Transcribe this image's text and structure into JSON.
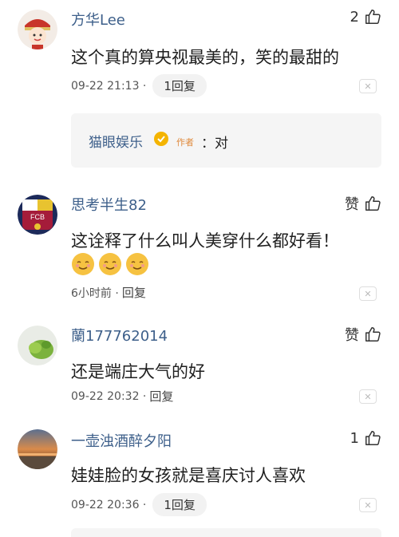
{
  "comments": [
    {
      "username": "方华Lee",
      "like_count": "2",
      "text": "这个真的算央视最美的，笑的最甜的",
      "time": "09-22 21:13 ·",
      "reply_label": "1回复",
      "close": "✕",
      "sub_reply": {
        "username": "猫眼娱乐",
        "author_tag": "作者",
        "text": "：对"
      }
    },
    {
      "username": "思考半生82",
      "like_count": "赞",
      "text": "这诠释了什么叫人美穿什么都好看！",
      "time": "6小时前 ·",
      "reply_label": "回复",
      "close": "✕"
    },
    {
      "username": "蘭177762014",
      "like_count": "赞",
      "text": "还是端庄大气的好",
      "time": "09-22 20:32 ·",
      "reply_label": "回复",
      "close": "✕"
    },
    {
      "username": "一壶浊酒醉夕阳",
      "like_count": "1",
      "text": "娃娃脸的女孩就是喜庆讨人喜欢",
      "time": "09-22 20:36 ·",
      "reply_label": "1回复",
      "close": "✕"
    }
  ],
  "colors": {
    "username": "#3d5f8a",
    "reply_bg": "#f5f5f5"
  },
  "icons": {
    "like": "thumbs-up-icon",
    "emoji": "smiling-face-emoji"
  }
}
